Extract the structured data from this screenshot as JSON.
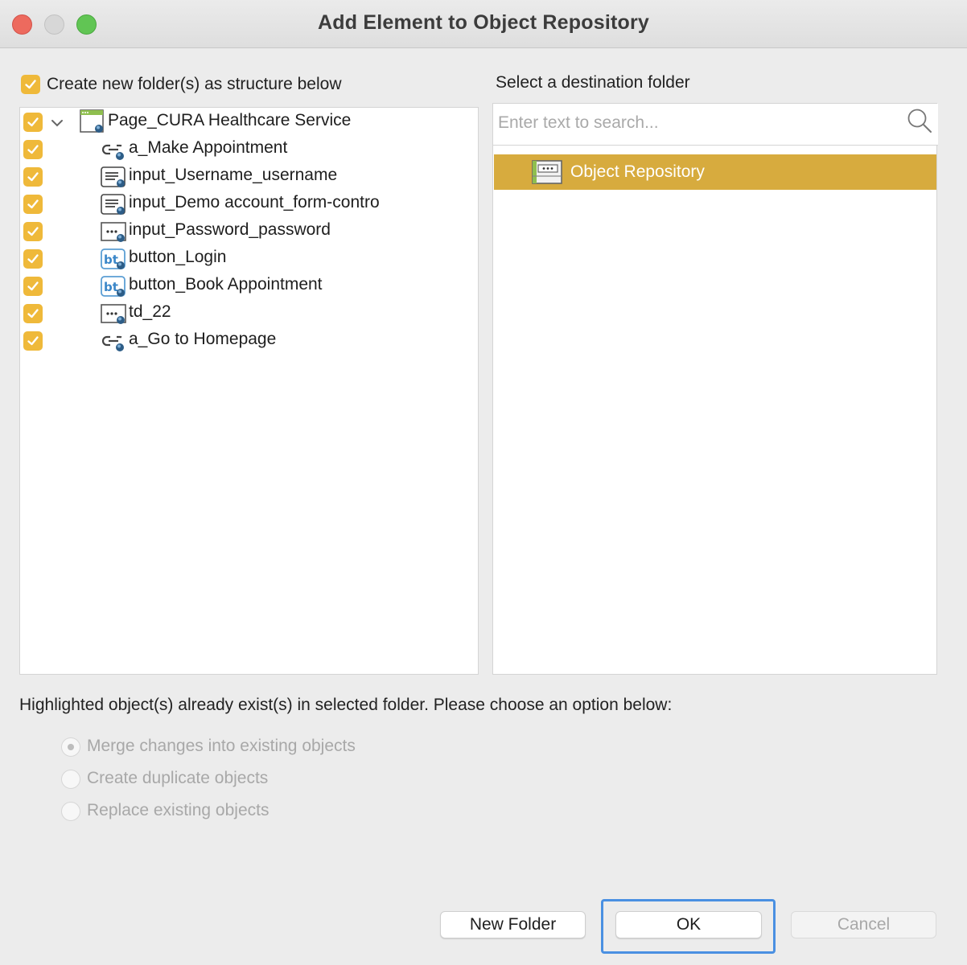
{
  "window": {
    "title": "Add Element to Object Repository"
  },
  "structure_option": {
    "label": "Create new folder(s) as structure below",
    "checked": true
  },
  "tree": {
    "root": {
      "label": "Page_CURA Healthcare Service",
      "icon": "page-icon",
      "expanded": true
    },
    "children": [
      {
        "label": "a_Make Appointment",
        "icon": "link-icon"
      },
      {
        "label": "input_Username_username",
        "icon": "text-input-icon"
      },
      {
        "label": "input_Demo account_form-contro",
        "icon": "text-input-icon"
      },
      {
        "label": "input_Password_password",
        "icon": "password-input-icon"
      },
      {
        "label": "button_Login",
        "icon": "button-icon"
      },
      {
        "label": "button_Book Appointment",
        "icon": "button-icon"
      },
      {
        "label": "td_22",
        "icon": "element-icon"
      },
      {
        "label": "a_Go to Homepage",
        "icon": "link-icon"
      }
    ]
  },
  "destination": {
    "label": "Select a destination folder",
    "search_placeholder": "Enter text to search...",
    "selected_folder": "Object Repository"
  },
  "conflict": {
    "message": "Highlighted object(s) already exist(s) in selected folder. Please choose an option below:",
    "options": [
      {
        "label": "Merge changes into existing objects",
        "selected": true
      },
      {
        "label": "Create duplicate objects",
        "selected": false
      },
      {
        "label": "Replace existing objects",
        "selected": false
      }
    ]
  },
  "buttons": {
    "new_folder": "New Folder",
    "ok": "OK",
    "cancel": "Cancel"
  },
  "colors": {
    "checkbox": "#efb93a",
    "selection": "#d7ab3e",
    "focus_ring": "#4a90e2"
  }
}
